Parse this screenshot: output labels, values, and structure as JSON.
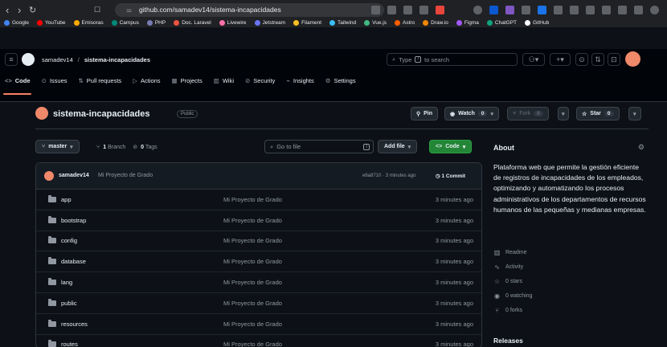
{
  "browser": {
    "url": "github.com/samadev14/sistema-incapacidades",
    "bookmarks": [
      "Google",
      "YouTube",
      "Emisoras",
      "Campus",
      "PHP",
      "Doc. Laravel",
      "Livewire",
      "Jetstream",
      "Filament",
      "Tailwind",
      "Vue.js",
      "Astro",
      "Draw.io",
      "Figma",
      "ChatGPT",
      "GitHub"
    ],
    "bookmark_colors": [
      "#4285f4",
      "#ff0000",
      "#f9ab00",
      "#00897b",
      "#777bb4",
      "#f05340",
      "#fb70a9",
      "#6875f5",
      "#fbbf24",
      "#38bdf8",
      "#42b883",
      "#ff5d01",
      "#f08705",
      "#a259ff",
      "#10a37f",
      "#ffffff"
    ]
  },
  "header": {
    "owner": "samadev14",
    "separator": "/",
    "repo": "sistema-incapacidades",
    "search_placeholder": "Type",
    "search_key": "/",
    "search_suffix": "to search"
  },
  "tabs": [
    {
      "icon": "<>",
      "label": "Code",
      "active": true
    },
    {
      "icon": "⊙",
      "label": "Issues"
    },
    {
      "icon": "⇅",
      "label": "Pull requests"
    },
    {
      "icon": "▷",
      "label": "Actions"
    },
    {
      "icon": "▦",
      "label": "Projects"
    },
    {
      "icon": "▥",
      "label": "Wiki"
    },
    {
      "icon": "⊘",
      "label": "Security"
    },
    {
      "icon": "⌁",
      "label": "Insights"
    },
    {
      "icon": "⚙",
      "label": "Settings"
    }
  ],
  "repo": {
    "title": "sistema-incapacidades",
    "visibility": "Public",
    "pin": "Pin",
    "watch": "Watch",
    "watch_count": "0",
    "fork": "Fork",
    "fork_count": "0",
    "star": "Star",
    "star_count": "0"
  },
  "controls": {
    "branch": "master",
    "branch_count": "1",
    "branch_label": "Branch",
    "tag_count": "0",
    "tag_label": "Tags",
    "goto_placeholder": "Go to file",
    "goto_key": "t",
    "add_file": "Add file",
    "code": "Code"
  },
  "commit": {
    "author": "samadev14",
    "message": "Mi Proyecto de Grado",
    "hash_time": "e6a8710 · 3 minutes ago",
    "count": "1 Commit"
  },
  "files": [
    {
      "name": "app",
      "message": "Mi Proyecto de Grado",
      "time": "3 minutes ago"
    },
    {
      "name": "bootstrap",
      "message": "Mi Proyecto de Grado",
      "time": "3 minutes ago"
    },
    {
      "name": "config",
      "message": "Mi Proyecto de Grado",
      "time": "3 minutes ago"
    },
    {
      "name": "database",
      "message": "Mi Proyecto de Grado",
      "time": "3 minutes ago"
    },
    {
      "name": "lang",
      "message": "Mi Proyecto de Grado",
      "time": "3 minutes ago"
    },
    {
      "name": "public",
      "message": "Mi Proyecto de Grado",
      "time": "3 minutes ago"
    },
    {
      "name": "resources",
      "message": "Mi Proyecto de Grado",
      "time": "3 minutes ago"
    },
    {
      "name": "routes",
      "message": "Mi Proyecto de Grado",
      "time": "3 minutes ago"
    }
  ],
  "about": {
    "title": "About",
    "description": "Plataforma web que permite la gestión eficiente de registros de incapacidades de los empleados, optimizando y automatizando los procesos administrativos de los departamentos de recursos humanos de las pequeñas y medianas empresas.",
    "links": [
      {
        "icon": "readme-icon",
        "label": "Readme"
      },
      {
        "icon": "activity-icon",
        "label": "Activity"
      },
      {
        "icon": "star-icon",
        "label": "0 stars"
      },
      {
        "icon": "eye-icon",
        "label": "0 watching"
      },
      {
        "icon": "fork-icon",
        "label": "0 forks"
      }
    ],
    "releases": "Releases"
  },
  "colors": {
    "accent": "#238636",
    "tab_underline": "#f78166",
    "background": "#0d1117"
  }
}
